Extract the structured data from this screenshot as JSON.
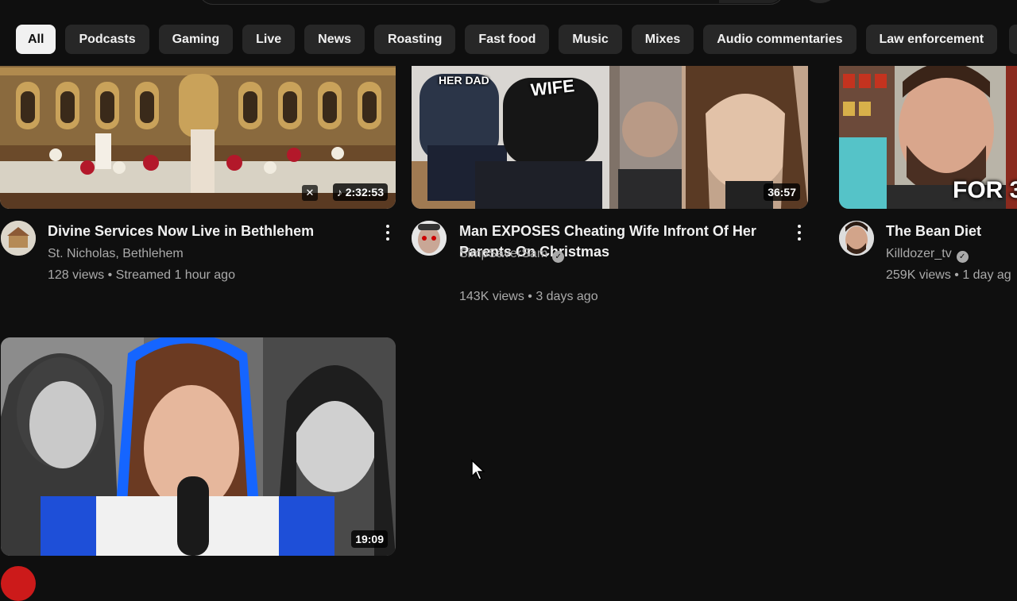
{
  "chips": [
    {
      "label": "All",
      "active": true
    },
    {
      "label": "Podcasts"
    },
    {
      "label": "Gaming"
    },
    {
      "label": "Live"
    },
    {
      "label": "News"
    },
    {
      "label": "Roasting"
    },
    {
      "label": "Fast food"
    },
    {
      "label": "Music"
    },
    {
      "label": "Mixes"
    },
    {
      "label": "Audio commentaries"
    },
    {
      "label": "Law enforcement"
    }
  ],
  "videos": [
    {
      "title": "Divine Services Now Live in Bethlehem",
      "channel": "St. Nicholas, Bethlehem",
      "stats": "128 views • Streamed 1 hour ago",
      "duration": "2:32:53"
    },
    {
      "title": "Man EXPOSES Cheating Wife Infront Of Her Parents On Christmas",
      "channel": "SimpSaverSam",
      "stats": "143K views • 3 days ago",
      "duration": "36:57",
      "thumb_text_1": "HER DAD",
      "thumb_text_2": "WIFE"
    },
    {
      "title": "The Bean Diet",
      "channel": "Killdozer_tv",
      "stats": "259K views • 1 day ag",
      "thumb_text": "FOR 3"
    },
    {
      "duration": "19:09"
    }
  ],
  "colors": {
    "background": "#0f0f0f",
    "chip": "#272727",
    "chip_active": "#f1f1f1",
    "secondary_text": "#aaaaaa"
  }
}
